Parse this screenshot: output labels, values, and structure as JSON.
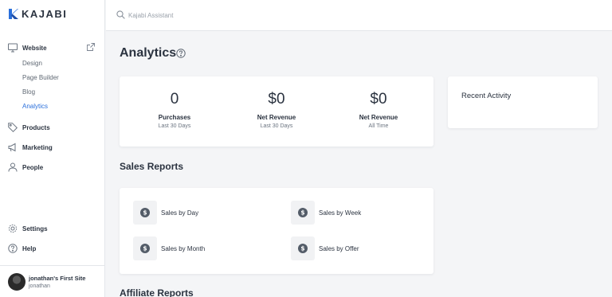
{
  "brand": {
    "name": "KAJABI",
    "color": "#2a6fdb"
  },
  "search": {
    "placeholder": "Kajabi Assistant",
    "value": ""
  },
  "sidebar": {
    "website": {
      "label": "Website",
      "icon": "monitor-icon",
      "external_icon": "external-link-icon"
    },
    "website_sub": [
      {
        "label": "Design",
        "active": false
      },
      {
        "label": "Page Builder",
        "active": false
      },
      {
        "label": "Blog",
        "active": false
      },
      {
        "label": "Analytics",
        "active": true
      }
    ],
    "items": [
      {
        "label": "Products",
        "icon": "tag-icon"
      },
      {
        "label": "Marketing",
        "icon": "megaphone-icon"
      },
      {
        "label": "People",
        "icon": "person-icon"
      }
    ],
    "bottom": [
      {
        "label": "Settings",
        "icon": "gear-icon"
      },
      {
        "label": "Help",
        "icon": "question-icon"
      }
    ],
    "user": {
      "site": "jonathan's First Site",
      "name": "jonathan"
    }
  },
  "main": {
    "title": "Analytics",
    "stats": [
      {
        "value": "0",
        "label": "Purchases",
        "period": "Last 30 Days"
      },
      {
        "value": "$0",
        "label": "Net Revenue",
        "period": "Last 30 Days"
      },
      {
        "value": "$0",
        "label": "Net Revenue",
        "period": "All Time"
      }
    ],
    "recent_activity": {
      "title": "Recent Activity"
    },
    "sales_reports": {
      "title": "Sales Reports",
      "items": [
        {
          "label": "Sales by Day",
          "icon": "dollar-circle-icon"
        },
        {
          "label": "Sales by Week",
          "icon": "dollar-circle-icon"
        },
        {
          "label": "Sales by Month",
          "icon": "dollar-circle-icon"
        },
        {
          "label": "Sales by Offer",
          "icon": "dollar-circle-icon"
        }
      ]
    },
    "affiliate_reports": {
      "title": "Affiliate Reports"
    }
  }
}
